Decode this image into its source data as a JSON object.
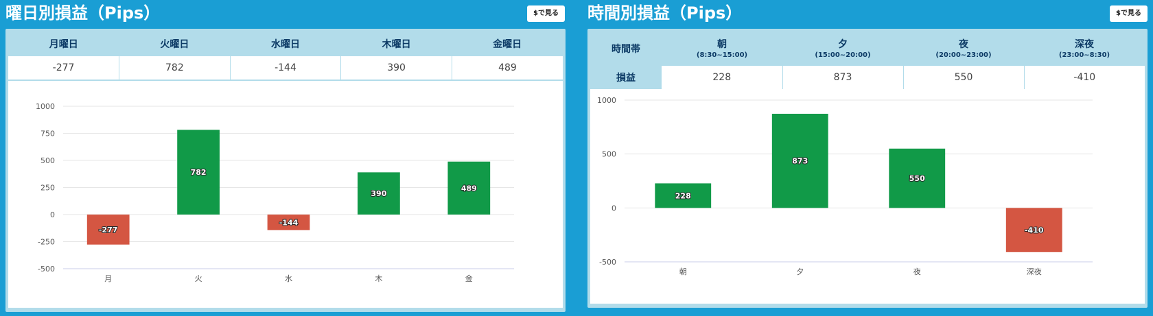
{
  "left": {
    "title": "曜日別損益（Pips）",
    "button": "$で見る",
    "headers": [
      "月曜日",
      "火曜日",
      "水曜日",
      "木曜日",
      "金曜日"
    ],
    "values": [
      "-277",
      "782",
      "-144",
      "390",
      "489"
    ]
  },
  "right": {
    "title": "時間別損益（Pips）",
    "button": "$で見る",
    "row_header_label": "時間帯",
    "row_value_label": "損益",
    "headers": [
      {
        "name": "朝",
        "range": "(8:30~15:00)"
      },
      {
        "name": "夕",
        "range": "(15:00~20:00)"
      },
      {
        "name": "夜",
        "range": "(20:00~23:00)"
      },
      {
        "name": "深夜",
        "range": "(23:00~8:30)"
      }
    ],
    "values": [
      "228",
      "873",
      "550",
      "-410"
    ]
  },
  "colors": {
    "positive": "#119a48",
    "negative": "#d45642",
    "background": "#1a9ed4",
    "card": "#b2dcea"
  },
  "chart_data": [
    {
      "type": "bar",
      "categories": [
        "月",
        "火",
        "水",
        "木",
        "金"
      ],
      "values": [
        -277,
        782,
        -144,
        390,
        489
      ],
      "ylim": [
        -500,
        1000
      ],
      "yticks": [
        -500,
        -250,
        0,
        250,
        500,
        750,
        1000
      ],
      "grid": true
    },
    {
      "type": "bar",
      "categories": [
        "朝",
        "夕",
        "夜",
        "深夜"
      ],
      "values": [
        228,
        873,
        550,
        -410
      ],
      "ylim": [
        -500,
        1000
      ],
      "yticks": [
        -500,
        0,
        500,
        1000
      ],
      "grid": true
    }
  ]
}
